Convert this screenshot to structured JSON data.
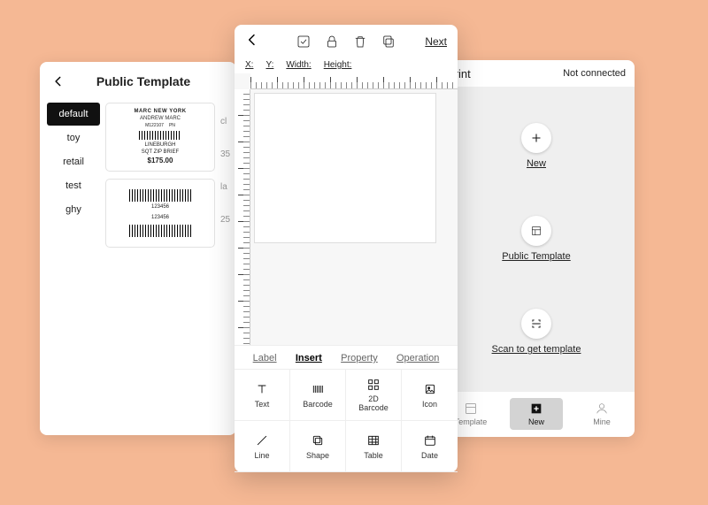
{
  "leftPhone": {
    "title": "Public Template",
    "categories": [
      "default",
      "toy",
      "retail",
      "test",
      "ghy"
    ],
    "activeCategory": "default",
    "templates": {
      "t1": {
        "brand": "MARC NEW YORK",
        "sub1": "ANDREW MARC",
        "code1": "M122107",
        "code2": "PN",
        "line1": "LINEBURGH",
        "line2": "SQT ZIP BRIEF",
        "price": "$175.00"
      },
      "t2": {
        "num1": "123456",
        "num2": "123456"
      }
    },
    "partial": {
      "p1a": "cl",
      "p1b": "35",
      "p2a": "la",
      "p2b": "25"
    }
  },
  "centerPhone": {
    "nextLabel": "Next",
    "coords": {
      "x": "X:",
      "y": "Y:",
      "w": "Width:",
      "h": "Height:"
    },
    "bottomTabs": [
      "Label",
      "Insert",
      "Property",
      "Operation"
    ],
    "activeBottomTab": "Insert",
    "tools": [
      "Text",
      "Barcode",
      "2D\nBarcode",
      "Icon",
      "Line",
      "Shape",
      "Table",
      "Date"
    ]
  },
  "rightPhone": {
    "titlePartial": "Print",
    "status": "Not connected",
    "actions": [
      "New",
      "Public Template",
      "Scan to get template"
    ],
    "tabs": [
      "Template",
      "New",
      "Mine"
    ],
    "activeTab": "New"
  }
}
